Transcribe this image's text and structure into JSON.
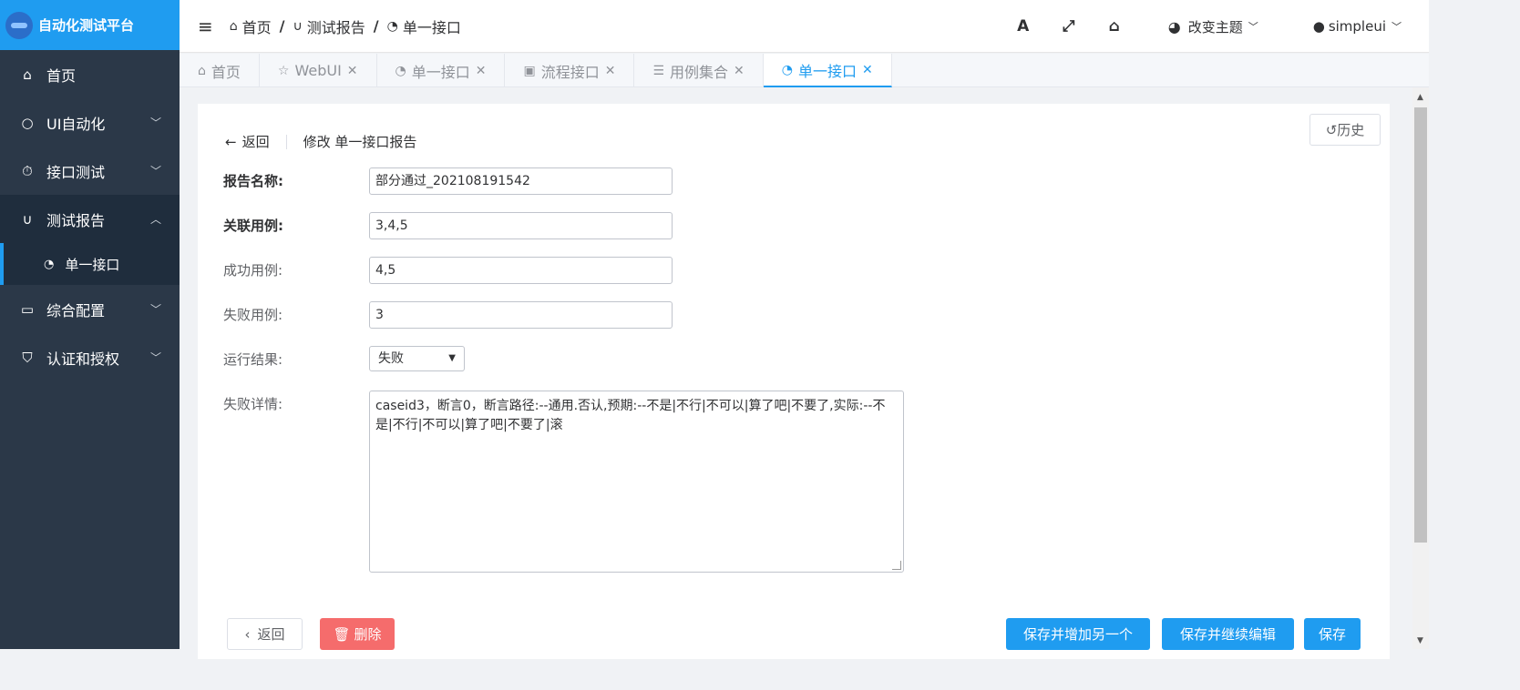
{
  "app": {
    "logo_text": "自动化测试平台"
  },
  "sidebar": {
    "items": [
      {
        "label": "首页"
      },
      {
        "label": "UI自动化"
      },
      {
        "label": "接口测试"
      },
      {
        "label": "测试报告"
      },
      {
        "label": "单一接口"
      },
      {
        "label": "综合配置"
      },
      {
        "label": "认证和授权"
      }
    ]
  },
  "header": {
    "breadcrumb": [
      "首页",
      "测试报告",
      "单一接口"
    ],
    "font_icon_label": "A",
    "theme_label": "改变主题",
    "user_label": "simpleui"
  },
  "tabs": [
    {
      "label": "首页",
      "icon": "home-icon",
      "closable": false
    },
    {
      "label": "WebUI",
      "icon": "star-icon",
      "closable": true
    },
    {
      "label": "单一接口",
      "icon": "gauge-icon",
      "closable": true
    },
    {
      "label": "流程接口",
      "icon": "report-icon",
      "closable": true
    },
    {
      "label": "用例集合",
      "icon": "list-icon",
      "closable": true
    },
    {
      "label": "单一接口",
      "icon": "gauge-icon",
      "closable": true,
      "active": true
    }
  ],
  "page": {
    "history_label": "历史",
    "back_label": "返回",
    "title": "修改 单一接口报告",
    "fields": {
      "report_name": {
        "label": "报告名称:",
        "value": "部分通过_202108191542"
      },
      "related_cases": {
        "label": "关联用例:",
        "value": "3,4,5"
      },
      "success_cases": {
        "label": "成功用例:",
        "value": "4,5"
      },
      "failed_cases": {
        "label": "失败用例:",
        "value": "3"
      },
      "run_result": {
        "label": "运行结果:",
        "value": "失败"
      },
      "fail_detail": {
        "label": "失败详情:",
        "value": "caseid3，断言0，断言路径:--通用.否认,预期:--不是|不行|不可以|算了吧|不要了,实际:--不是|不行|不可以|算了吧|不要了|滚"
      }
    },
    "buttons": {
      "back": "返回",
      "delete": "删除",
      "save_add": "保存并增加另一个",
      "save_continue": "保存并继续编辑",
      "save": "保存"
    }
  },
  "colors": {
    "accent": "#1f9cf0",
    "sidebar_bg": "#2b3848",
    "danger": "#f56c6c"
  }
}
